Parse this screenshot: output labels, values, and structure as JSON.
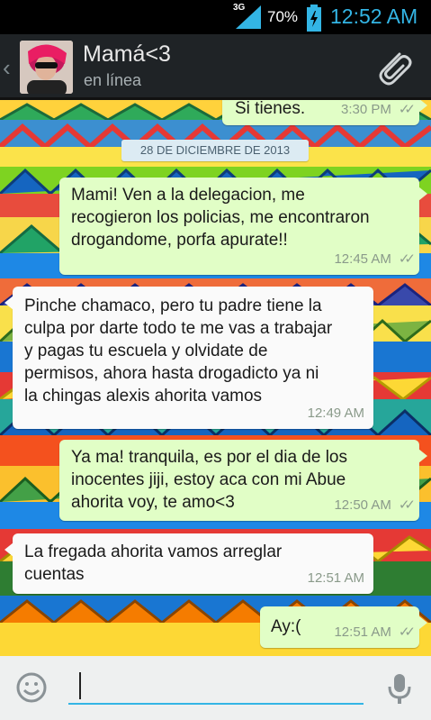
{
  "statusbar": {
    "network": "3G",
    "battery_percent": "70%",
    "time": "12:52 AM",
    "icons": [
      "signal-icon",
      "battery-charging-icon"
    ]
  },
  "header": {
    "contact_name": "Mamá<3",
    "status": "en línea",
    "icons": [
      "back-icon",
      "avatar",
      "attach-paperclip-icon"
    ]
  },
  "chat": {
    "date_separator": "28 DE DICIEMBRE DE 2013",
    "messages": [
      {
        "direction": "out",
        "text": "Si tienes.",
        "time": "3:30 PM",
        "read": true
      },
      {
        "direction": "out",
        "text": "Mami! Ven a la delegacion, me\nrecogieron los policias, me encontraron\ndrogandome, porfa apurate!!",
        "time": "12:45 AM",
        "read": true
      },
      {
        "direction": "in",
        "text": "Pinche chamaco, pero tu padre tiene la\nculpa por darte todo te me vas a trabajar\ny pagas tu escuela y olvidate de\npermisos, ahora hasta drogadicto ya ni\nla chingas alexis ahorita vamos",
        "time": "12:49 AM"
      },
      {
        "direction": "out",
        "text": "Ya ma! tranquila, es por el dia de los\ninocentes jiji, estoy aca con mi Abue\nahorita voy, te amo<3",
        "time": "12:50 AM",
        "read": true
      },
      {
        "direction": "in",
        "text": "La fregada ahorita vamos arreglar\ncuentas",
        "time": "12:51 AM"
      },
      {
        "direction": "out",
        "text": "Ay:(",
        "time": "12:51 AM",
        "read": true
      }
    ]
  },
  "composer": {
    "value": "",
    "placeholder": "",
    "icons": [
      "emoji-icon",
      "microphone-icon"
    ]
  },
  "colors": {
    "outgoing_bubble": "#e1fec6",
    "incoming_bubble": "#fafafa",
    "accent": "#33b5e5",
    "header_bg": "#1f2326"
  }
}
